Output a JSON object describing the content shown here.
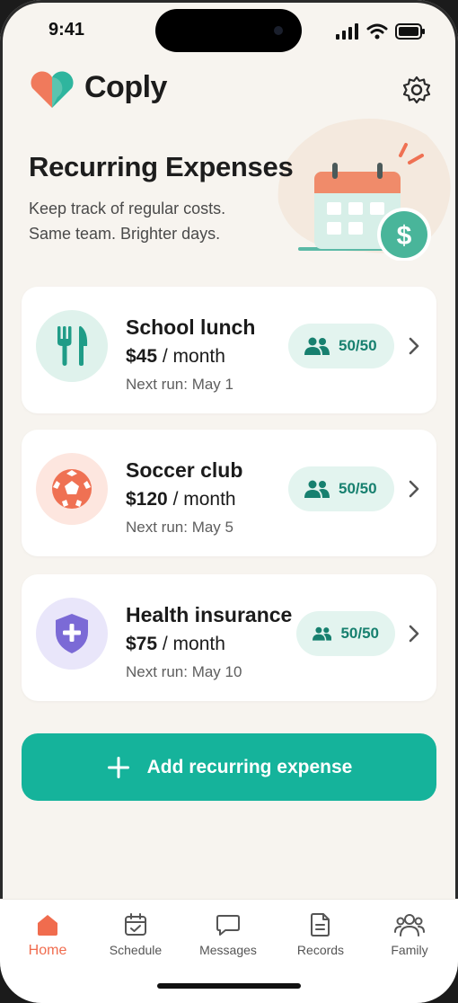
{
  "status_bar": {
    "time": "9:41"
  },
  "app": {
    "name": "Coply"
  },
  "page": {
    "title": "Recurring Expenses",
    "subtitle_line1": "Keep track of regular costs.",
    "subtitle_line2": "Same team. Brighter days."
  },
  "expenses": [
    {
      "name": "School lunch",
      "amount": "$45",
      "period": "/ month",
      "next_run": "Next run: May 1",
      "split": "50/50",
      "icon": "utensils-icon",
      "icon_bg": "#dff2ec",
      "icon_color": "#1f9c87"
    },
    {
      "name": "Soccer club",
      "amount": "$120",
      "period": "/ month",
      "next_run": "Next run: May 5",
      "split": "50/50",
      "icon": "soccer-ball-icon",
      "icon_bg": "#fde6df",
      "icon_color": "#ef7153"
    },
    {
      "name": "Health insurance",
      "amount": "$75",
      "period": "/ month",
      "next_run": "Next run: May 10",
      "split": "50/50",
      "icon": "shield-plus-icon",
      "icon_bg": "#e9e6fa",
      "icon_color": "#7b6ad6"
    }
  ],
  "add_button": {
    "label": "Add recurring expense"
  },
  "tabs": [
    {
      "label": "Home",
      "icon": "home-icon",
      "active": true
    },
    {
      "label": "Schedule",
      "icon": "calendar-check-icon",
      "active": false
    },
    {
      "label": "Messages",
      "icon": "message-icon",
      "active": false
    },
    {
      "label": "Records",
      "icon": "document-icon",
      "active": false
    },
    {
      "label": "Family",
      "icon": "family-icon",
      "active": false
    }
  ],
  "colors": {
    "accent": "#15b39b",
    "active_tab": "#f06c4e",
    "background": "#f7f4ef",
    "badge_bg": "#e3f4ef",
    "badge_text": "#17806f"
  }
}
